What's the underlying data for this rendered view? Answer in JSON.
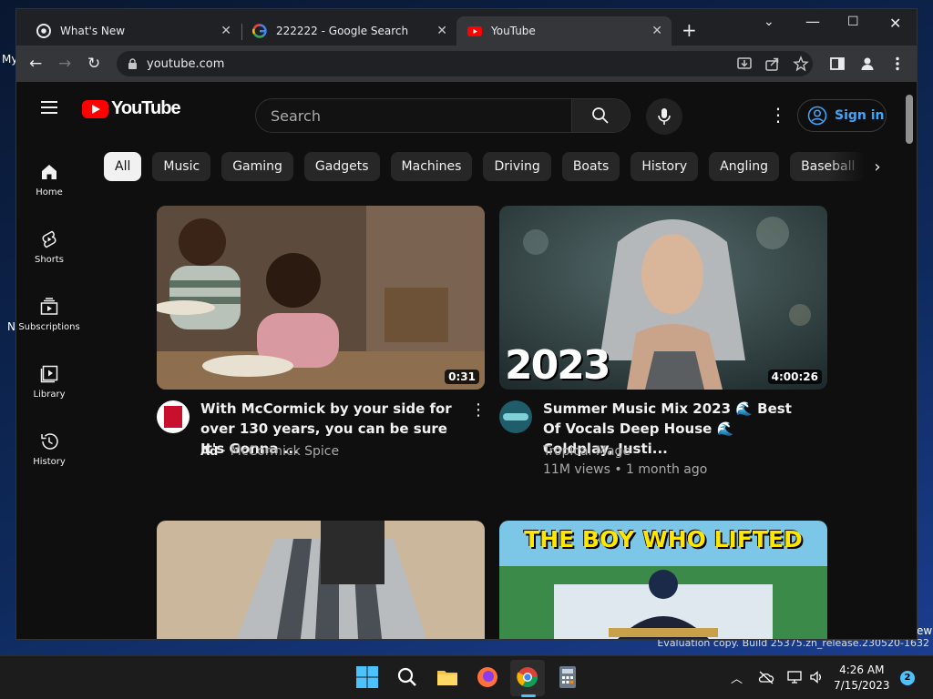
{
  "desktop": {
    "fragments": [
      "My",
      "N",
      "ew"
    ],
    "watermark": "Evaluation copy. Build 25375.zn_release.230520-1632"
  },
  "browser": {
    "tabs": [
      {
        "title": "What's New",
        "favicon": "chrome-icon",
        "active": false
      },
      {
        "title": "222222 - Google Search",
        "favicon": "google-icon",
        "active": false
      },
      {
        "title": "YouTube",
        "favicon": "youtube-icon",
        "active": true
      }
    ],
    "new_tab_label": "+",
    "address": "youtube.com"
  },
  "youtube": {
    "logo_text": "YouTube",
    "search_placeholder": "Search",
    "sign_in_label": "Sign in",
    "chips": [
      "All",
      "Music",
      "Gaming",
      "Gadgets",
      "Machines",
      "Driving",
      "Boats",
      "History",
      "Angling",
      "Baseball"
    ],
    "selected_chip": "All",
    "sidebar": [
      {
        "label": "Home",
        "icon": "home-icon"
      },
      {
        "label": "Shorts",
        "icon": "shorts-icon"
      },
      {
        "label": "Subscriptions",
        "icon": "subscriptions-icon"
      },
      {
        "label": "Library",
        "icon": "library-icon"
      },
      {
        "label": "History",
        "icon": "history-icon"
      }
    ],
    "videos": [
      {
        "title": "With McCormick by your side for over 130 years, you can be sure It's Gonna ...",
        "ad_label": "Ad",
        "channel": "McCormick Spice",
        "duration": "0:31",
        "stats": ""
      },
      {
        "title": "Summer Music Mix 2023 🌊 Best Of Vocals Deep House 🌊 Coldplay, Justi...",
        "thumb_text": "2023",
        "channel": "Tropical Mage",
        "duration": "4:00:26",
        "stats": "11M views • 1 month ago"
      },
      {
        "title": "",
        "thumb_text": ""
      },
      {
        "title": "",
        "thumb_text": "THE BOY WHO LIFTED"
      }
    ]
  },
  "taskbar": {
    "time": "4:26 AM",
    "date": "7/15/2023",
    "notification_count": "2"
  },
  "colors": {
    "yt_bg": "#0f0f0f",
    "yt_red": "#ff0000",
    "link_blue": "#3ea6ff",
    "chrome_toolbar": "#35363a"
  }
}
